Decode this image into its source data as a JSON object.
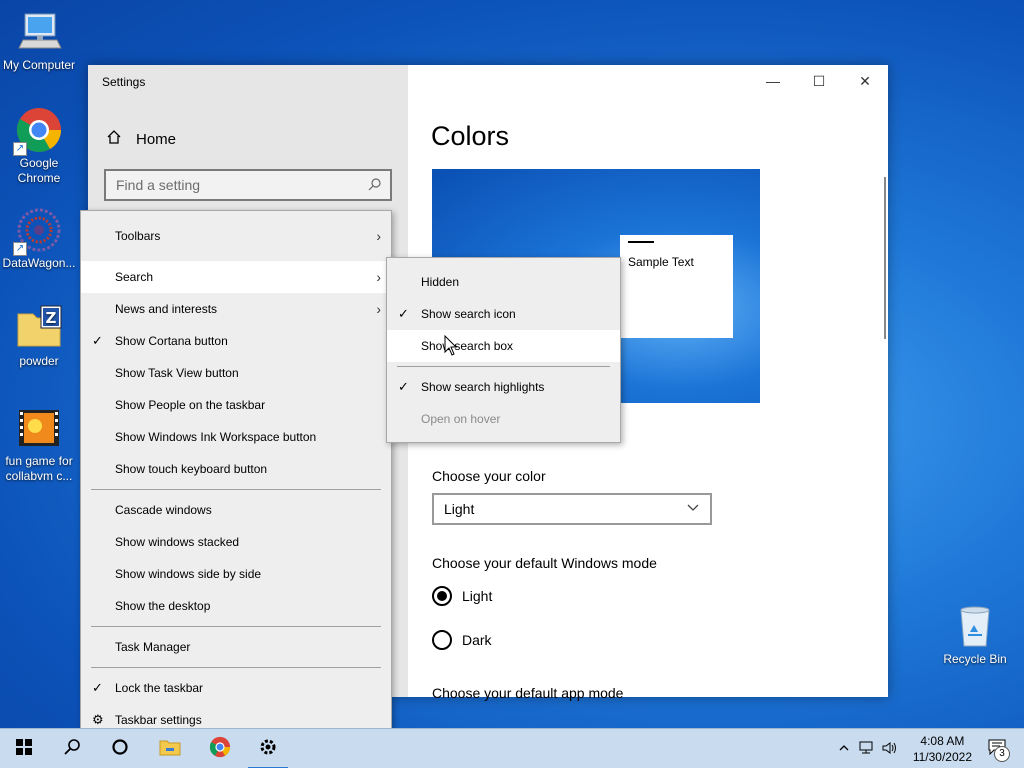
{
  "desktop": {
    "icons": [
      {
        "label": "My Computer",
        "icon": "computer-icon"
      },
      {
        "label": "Google Chrome",
        "icon": "chrome-icon"
      },
      {
        "label": "DataWagon...",
        "icon": "datawagon-icon"
      },
      {
        "label": "powder",
        "icon": "zip-folder-icon"
      },
      {
        "label": "fun game for collabvm c...",
        "icon": "video-icon"
      },
      {
        "label": "Recycle Bin",
        "icon": "recycle-bin-icon"
      }
    ]
  },
  "settings": {
    "title": "Settings",
    "home_label": "Home",
    "search_placeholder": "Find a setting",
    "page_title": "Colors",
    "preview_sample_text": "Sample Text",
    "choose_color_label": "Choose your color",
    "choose_color_value": "Light",
    "windows_mode_label": "Choose your default Windows mode",
    "windows_mode_options": [
      {
        "label": "Light",
        "selected": true
      },
      {
        "label": "Dark",
        "selected": false
      }
    ],
    "app_mode_label": "Choose your default app mode"
  },
  "taskbar_menu": {
    "items": [
      {
        "label": "Toolbars",
        "submenu": true
      },
      {
        "label": "Search",
        "submenu": true,
        "hover": true
      },
      {
        "label": "News and interests",
        "submenu": true
      },
      {
        "label": "Show Cortana button",
        "checked": true
      },
      {
        "label": "Show Task View button"
      },
      {
        "label": "Show People on the taskbar"
      },
      {
        "label": "Show Windows Ink Workspace button"
      },
      {
        "label": "Show touch keyboard button"
      },
      {
        "label": "Cascade windows"
      },
      {
        "label": "Show windows stacked"
      },
      {
        "label": "Show windows side by side"
      },
      {
        "label": "Show the desktop"
      },
      {
        "label": "Task Manager"
      },
      {
        "label": "Lock the taskbar",
        "checked": true
      },
      {
        "label": "Taskbar settings",
        "icon": "gear-icon"
      }
    ]
  },
  "search_submenu": {
    "items": [
      {
        "label": "Hidden"
      },
      {
        "label": "Show search icon",
        "checked": true
      },
      {
        "label": "Show search box",
        "hover": true
      },
      {
        "label": "Show search highlights",
        "checked": true
      },
      {
        "label": "Open on hover",
        "disabled": true
      }
    ]
  },
  "taskbar": {
    "time": "4:08 AM",
    "date": "11/30/2022",
    "notification_count": "3"
  },
  "colors": {
    "accent": "#0078d7",
    "taskbar_bg": "#c8dbef",
    "menu_bg": "#eeeeee"
  }
}
